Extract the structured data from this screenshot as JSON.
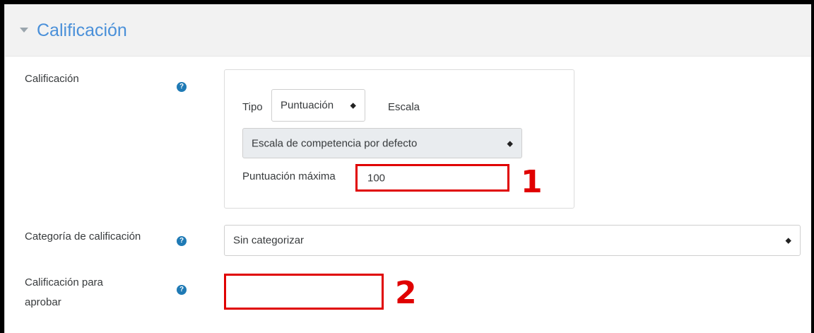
{
  "section": {
    "title": "Calificación"
  },
  "grade": {
    "label": "Calificación",
    "tipo_label": "Tipo",
    "tipo_value": "Puntuación",
    "escala_label": "Escala",
    "scale_value": "Escala de competencia por defecto",
    "max_label": "Puntuación máxima",
    "max_value": "100"
  },
  "category": {
    "label": "Categoría de calificación",
    "value": "Sin categorizar"
  },
  "pass": {
    "label_line1": "Calificación para",
    "label_line2": "aprobar",
    "value": ""
  },
  "icons": {
    "help": "?",
    "sort_arrow": "◆"
  },
  "annotations": {
    "one": "1",
    "two": "2",
    "color": "#e00000"
  }
}
